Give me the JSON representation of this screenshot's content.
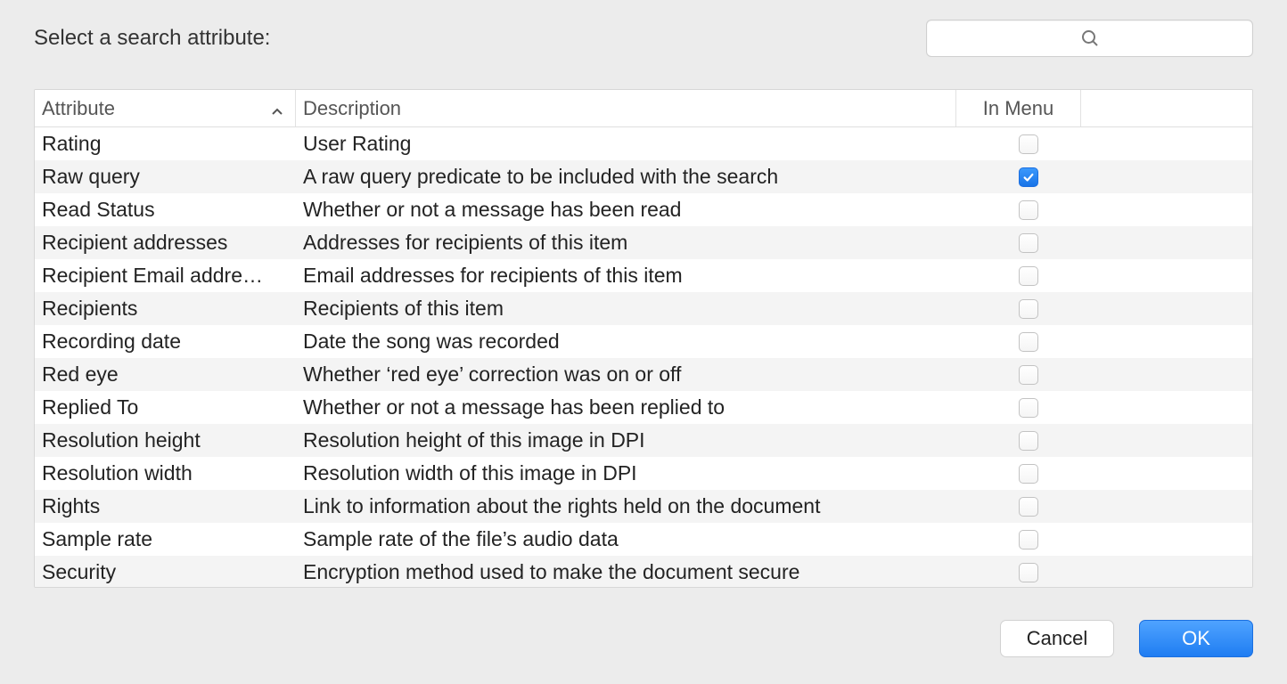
{
  "prompt": "Select a search attribute:",
  "search": {
    "placeholder": ""
  },
  "columns": {
    "attribute": "Attribute",
    "description": "Description",
    "inMenu": "In Menu"
  },
  "rows": [
    {
      "attr": "Rating",
      "desc": "User Rating",
      "inMenu": false
    },
    {
      "attr": "Raw query",
      "desc": "A raw query predicate to be included with the search",
      "inMenu": true
    },
    {
      "attr": "Read Status",
      "desc": "Whether or not a message has been read",
      "inMenu": false
    },
    {
      "attr": "Recipient addresses",
      "desc": "Addresses for recipients of this item",
      "inMenu": false
    },
    {
      "attr": "Recipient Email addre…",
      "desc": "Email addresses for recipients of this item",
      "inMenu": false
    },
    {
      "attr": "Recipients",
      "desc": "Recipients of this item",
      "inMenu": false
    },
    {
      "attr": "Recording date",
      "desc": "Date the song was recorded",
      "inMenu": false
    },
    {
      "attr": "Red eye",
      "desc": "Whether ‘red eye’ correction was on or off",
      "inMenu": false
    },
    {
      "attr": "Replied To",
      "desc": "Whether or not a message has been replied to",
      "inMenu": false
    },
    {
      "attr": "Resolution height",
      "desc": "Resolution height of this image in DPI",
      "inMenu": false
    },
    {
      "attr": "Resolution width",
      "desc": "Resolution width of this image in DPI",
      "inMenu": false
    },
    {
      "attr": "Rights",
      "desc": "Link to information about the rights held on the document",
      "inMenu": false
    },
    {
      "attr": "Sample rate",
      "desc": "Sample rate of the file’s audio data",
      "inMenu": false
    },
    {
      "attr": "Security",
      "desc": "Encryption method used to make the document secure",
      "inMenu": false
    }
  ],
  "buttons": {
    "cancel": "Cancel",
    "ok": "OK"
  }
}
